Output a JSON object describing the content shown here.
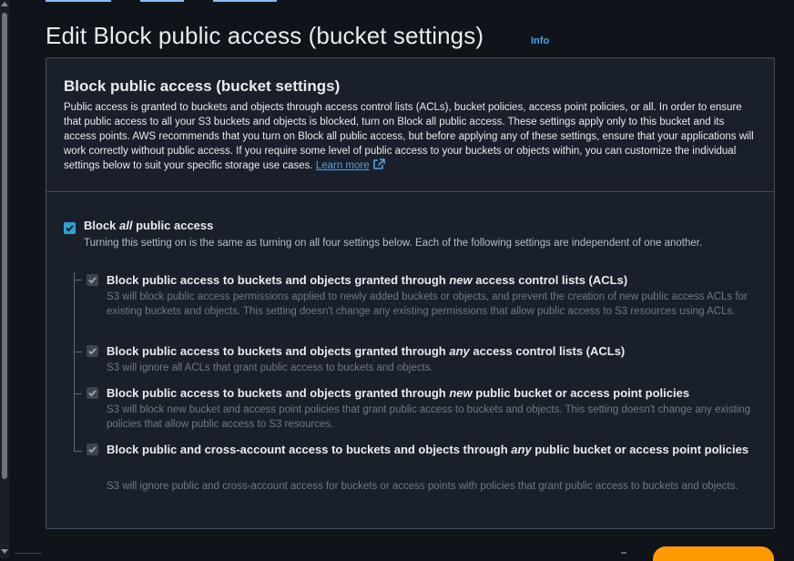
{
  "header": {
    "title": "Edit Block public access (bucket settings)",
    "info": "Info"
  },
  "panel": {
    "title": "Block public access (bucket settings)",
    "description": "Public access is granted to buckets and objects through access control lists (ACLs), bucket policies, access point policies, or all. In order to ensure that public access to all your S3 buckets and objects is blocked, turn on Block all public access. These settings apply only to this bucket and its access points. AWS recommends that you turn on Block all public access, but before applying any of these settings, ensure that your applications will work correctly without public access. If you require some level of public access to your buckets or objects within, you can customize the individual settings below to suit your specific storage use cases.",
    "learn_more": "Learn more"
  },
  "master": {
    "label_pre": "Block ",
    "label_em": "all",
    "label_post": " public access",
    "description": "Turning this setting on is the same as turning on all four settings below. Each of the following settings are independent of one another.",
    "checked": true
  },
  "settings": [
    {
      "label_pre": "Block public access to buckets and objects granted through ",
      "label_em": "new",
      "label_post": " access control lists (ACLs)",
      "description": "S3 will block public access permissions applied to newly added buckets or objects, and prevent the creation of new public access ACLs for existing buckets and objects. This setting doesn't change any existing permissions that allow public access to S3 resources using ACLs."
    },
    {
      "label_pre": "Block public access to buckets and objects granted through ",
      "label_em": "any",
      "label_post": " access control lists (ACLs)",
      "description": "S3 will ignore all ACLs that grant public access to buckets and objects."
    },
    {
      "label_pre": "Block public access to buckets and objects granted through ",
      "label_em": "new",
      "label_post": " public bucket or access point policies",
      "description": "S3 will block new bucket and access point policies that grant public access to buckets and objects. This setting doesn't change any existing policies that allow public access to S3 resources."
    },
    {
      "label_pre": "Block public and cross-account access to buckets and objects through ",
      "label_em": "any",
      "label_post": " public bucket or access point policies",
      "description": "S3 will ignore public and cross-account access for buckets or access points with policies that grant public access to buckets and objects."
    }
  ],
  "colors": {
    "accent": "#2ea2d4",
    "link": "#539fe5",
    "primary_button": "#ff9900",
    "panel_bg": "#1a2029"
  }
}
